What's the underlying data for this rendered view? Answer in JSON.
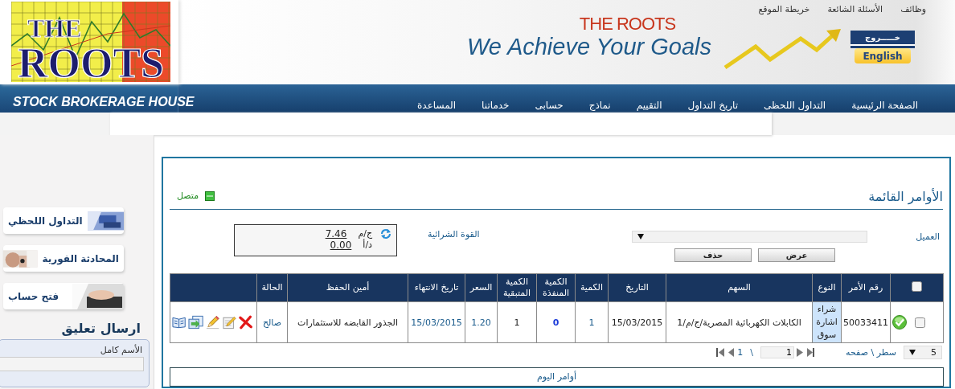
{
  "header": {
    "logo": {
      "line_1": "THE",
      "line_2": "ROOTS"
    },
    "top_links": [
      "وظائف",
      "الأسئلة الشائعة",
      "خريطة الموقع"
    ],
    "brand": "THE ROOTS",
    "tagline": "We Achieve Your Goals",
    "exit_button": "خـــــروج",
    "language_button": "English"
  },
  "navbar": {
    "subtitle": "STOCK BROKERAGE HOUSE",
    "items": [
      "الصفحة الرئيسية",
      "التداول اللحظى",
      "تاريخ التداول",
      "التقييم",
      "نماذج",
      "حسابى",
      "خدماتنا",
      "المساعدة"
    ]
  },
  "sidebar": {
    "banners": [
      {
        "label": "التداول اللحظي",
        "picture_left": false
      },
      {
        "label": "المحادثة الفورية",
        "picture_left": true
      },
      {
        "label": "فتح حساب",
        "picture_left": false
      }
    ],
    "feedback": {
      "title": "ارسال تعليق",
      "fields": [
        {
          "label": "الأسم كامل"
        }
      ]
    }
  },
  "orders_panel": {
    "title": "الأوامر القائمة",
    "connection": {
      "label": "متصل",
      "connected": true
    },
    "client": {
      "label": "العميل"
    },
    "buying_power": {
      "label": "القوة الشرائية",
      "rows": [
        {
          "value": "7.46",
          "unit": "ج/م"
        },
        {
          "value": "0.00",
          "unit": "د/أ"
        }
      ]
    },
    "buttons": [
      "عرض",
      "حذف"
    ],
    "table": {
      "columns": [
        {
          "kind": "checkbox",
          "checked": false
        },
        {
          "kind": "text",
          "label": "رقم الأمر"
        },
        {
          "kind": "text",
          "label": "النوع"
        },
        {
          "kind": "text",
          "label": "السهم"
        },
        {
          "kind": "text",
          "label": "التاريخ"
        },
        {
          "kind": "text",
          "label": "الكمية"
        },
        {
          "kind": "text",
          "label": "الكمية المنفذة"
        },
        {
          "kind": "text",
          "label": "الكمية المتبقية"
        },
        {
          "kind": "text",
          "label": "السعر"
        },
        {
          "kind": "text",
          "label": "تاريخ الانتهاء"
        },
        {
          "kind": "text",
          "label": "أمين الحفظ"
        },
        {
          "kind": "text",
          "label": "الحالة"
        },
        {
          "kind": "blank"
        }
      ],
      "rows": [
        {
          "checked": false,
          "confirmed": true,
          "order_no": "50033411",
          "type": "شراء اشارة سوق",
          "stock": "الكابلات الكهربائية المصرية/ج/م/1",
          "date": "15/03/2015",
          "quantity": "1",
          "executed": "0",
          "remaining": "1",
          "price": "1.20",
          "expiry": "15/03/2015",
          "custodian": "الجذور القابضه للاستثمارات",
          "status": "صالح"
        }
      ]
    },
    "pager": {
      "rows_per_page": "5",
      "rows_per_page_label": "سطر \\ صفحه",
      "total_pages": "1",
      "separator": "\\",
      "current_page": "1"
    },
    "today_orders": "أوامر اليوم"
  }
}
